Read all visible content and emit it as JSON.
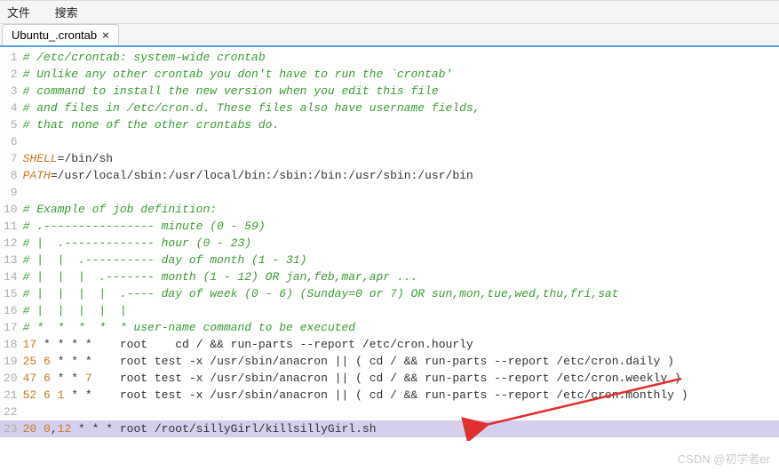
{
  "menubar": {
    "file": "文件",
    "search": "搜索"
  },
  "tab": {
    "name": "Ubuntu_.crontab",
    "close": "×"
  },
  "gutter_highlight": 23,
  "lines": [
    {
      "n": 1,
      "t": "comment",
      "text": "# /etc/crontab: system-wide crontab"
    },
    {
      "n": 2,
      "t": "comment",
      "text": "# Unlike any other crontab you don't have to run the `crontab'"
    },
    {
      "n": 3,
      "t": "comment",
      "text": "# command to install the new version when you edit this file"
    },
    {
      "n": 4,
      "t": "comment",
      "text": "# and files in /etc/cron.d. These files also have username fields,"
    },
    {
      "n": 5,
      "t": "comment",
      "text": "# that none of the other crontabs do."
    },
    {
      "n": 6,
      "t": "blank",
      "text": ""
    },
    {
      "n": 7,
      "t": "assign",
      "var": "SHELL",
      "op": "=",
      "val": "/bin/sh"
    },
    {
      "n": 8,
      "t": "assign",
      "var": "PATH",
      "op": "=",
      "val": "/usr/local/sbin:/usr/local/bin:/sbin:/bin:/usr/sbin:/usr/bin"
    },
    {
      "n": 9,
      "t": "blank",
      "text": ""
    },
    {
      "n": 10,
      "t": "comment",
      "text": "# Example of job definition:"
    },
    {
      "n": 11,
      "t": "comment",
      "text": "# .---------------- minute (0 - 59)"
    },
    {
      "n": 12,
      "t": "comment",
      "text": "# |  .------------- hour (0 - 23)"
    },
    {
      "n": 13,
      "t": "comment",
      "text": "# |  |  .---------- day of month (1 - 31)"
    },
    {
      "n": 14,
      "t": "comment",
      "text": "# |  |  |  .------- month (1 - 12) OR jan,feb,mar,apr ..."
    },
    {
      "n": 15,
      "t": "comment",
      "text": "# |  |  |  |  .---- day of week (0 - 6) (Sunday=0 or 7) OR sun,mon,tue,wed,thu,fri,sat"
    },
    {
      "n": 16,
      "t": "comment",
      "text": "# |  |  |  |  |"
    },
    {
      "n": 17,
      "t": "comment",
      "text": "# *  *  *  *  * user-name command to be executed"
    },
    {
      "n": 18,
      "t": "cron",
      "time": "17 ",
      "stars": "* * * *",
      "rest": "    root    cd / && run-parts --report /etc/cron.hourly"
    },
    {
      "n": 19,
      "t": "cron",
      "time": "25 6 ",
      "stars": "* * *",
      "rest": "    root test -x /usr/sbin/anacron || ( cd / && run-parts --report /etc/cron.daily )"
    },
    {
      "n": 20,
      "t": "cron",
      "time": "47 6 ",
      "stars": "* * ",
      "rest2": "7",
      "rest": "    root test -x /usr/sbin/anacron || ( cd / && run-parts --report /etc/cron.weekly )"
    },
    {
      "n": 21,
      "t": "cron",
      "time": "52 6 1 ",
      "stars": "* *",
      "rest": "    root test -x /usr/sbin/anacron || ( cd / && run-parts --report /etc/cron.monthly )"
    },
    {
      "n": 22,
      "t": "blank",
      "text": ""
    },
    {
      "n": 23,
      "t": "cronhl",
      "time": "20 0",
      "comma": ",",
      "time2": "12 ",
      "stars": "* * *",
      "rest": " root /root/sillyGirl/killsillyGirl.sh"
    }
  ],
  "watermark": "CSDN @初学者er"
}
